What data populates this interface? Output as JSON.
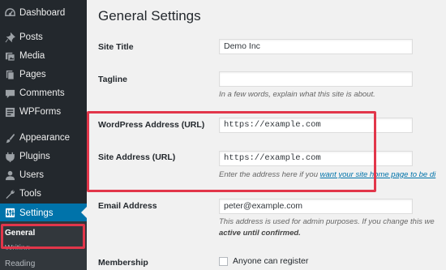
{
  "sidebar": {
    "items": [
      {
        "label": "Dashboard",
        "icon": "dashboard-icon"
      },
      {
        "label": "Posts",
        "icon": "pin-icon"
      },
      {
        "label": "Media",
        "icon": "media-icon"
      },
      {
        "label": "Pages",
        "icon": "pages-icon"
      },
      {
        "label": "Comments",
        "icon": "comment-icon"
      },
      {
        "label": "WPForms",
        "icon": "forms-icon"
      },
      {
        "label": "Appearance",
        "icon": "brush-icon"
      },
      {
        "label": "Plugins",
        "icon": "plugin-icon"
      },
      {
        "label": "Users",
        "icon": "user-icon"
      },
      {
        "label": "Tools",
        "icon": "wrench-icon"
      },
      {
        "label": "Settings",
        "icon": "settings-icon"
      }
    ],
    "submenu": {
      "general": "General",
      "writing": "Writing",
      "reading": "Reading"
    }
  },
  "page": {
    "title": "General Settings"
  },
  "fields": {
    "site_title": {
      "label": "Site Title",
      "value": "Demo Inc"
    },
    "tagline": {
      "label": "Tagline",
      "value": "",
      "description": "In a few words, explain what this site is about."
    },
    "wordpress_address": {
      "label": "WordPress Address (URL)",
      "value": "https://example.com"
    },
    "site_address": {
      "label": "Site Address (URL)",
      "value": "https://example.com",
      "description_prefix": "Enter the address here if you ",
      "description_link": "want your site home page to be di"
    },
    "email": {
      "label": "Email Address",
      "value": "peter@example.com",
      "description_line1": "This address is used for admin purposes. If you change this we",
      "description_line2": "active until confirmed."
    },
    "membership": {
      "label": "Membership",
      "checkbox_label": "Anyone can register"
    }
  },
  "colors": {
    "accent": "#0073aa",
    "highlight": "#e2364a",
    "sidebar_bg": "#23282d"
  }
}
